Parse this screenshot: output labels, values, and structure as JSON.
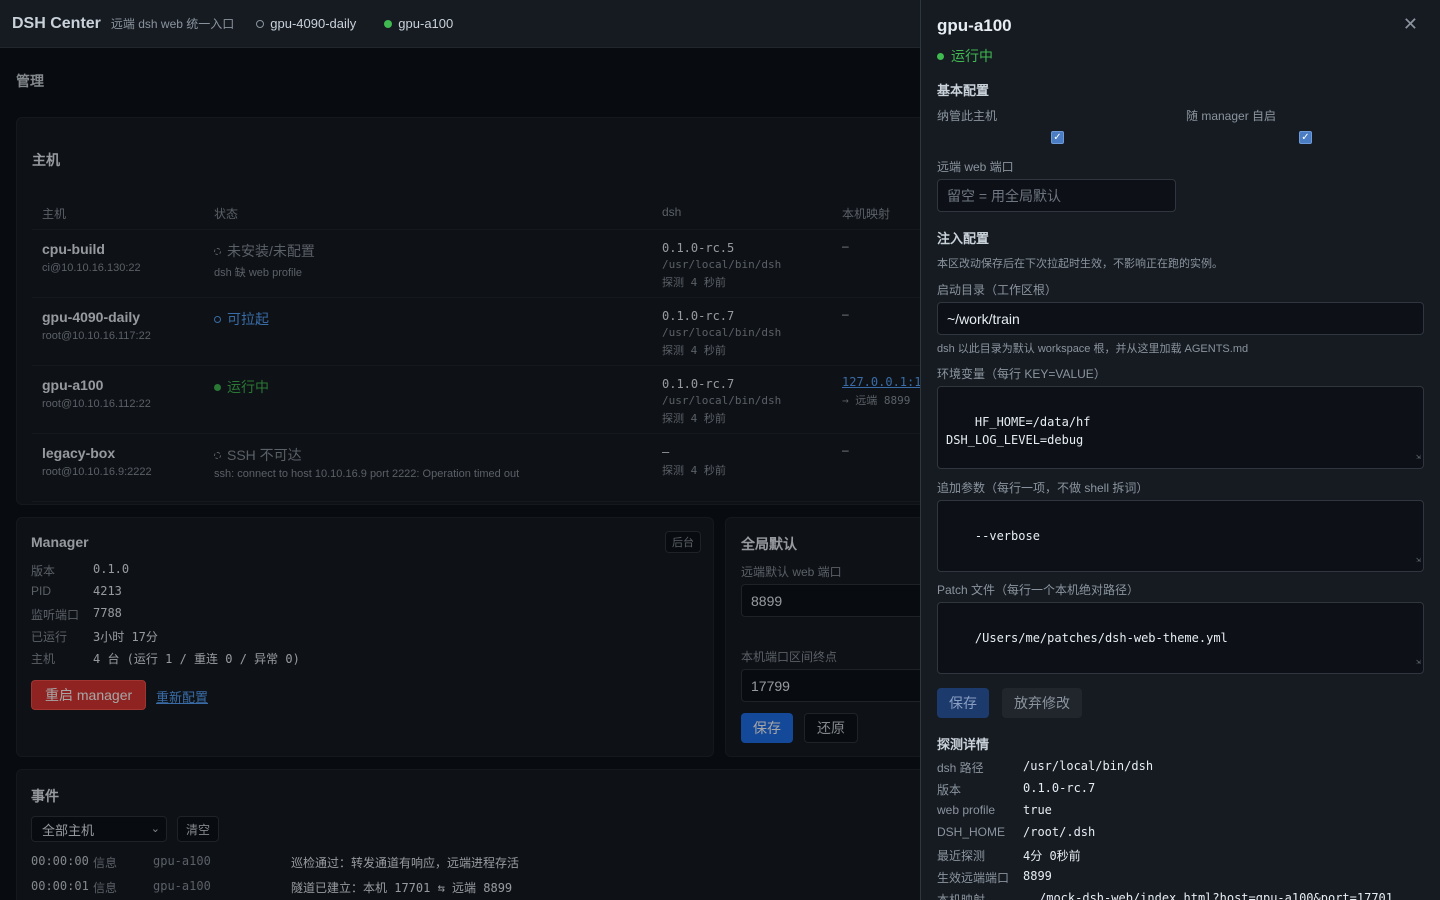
{
  "topbar": {
    "brand": "DSH Center",
    "subtitle": "远端 dsh web 统一入口",
    "tabs": [
      "gpu-4090-daily",
      "gpu-a100"
    ]
  },
  "page_title": "管理",
  "hosts": {
    "title": "主机",
    "columns": [
      "主机",
      "状态",
      "dsh",
      "本机映射"
    ],
    "rows": [
      {
        "name": "cpu-build",
        "addr": "ci@10.10.16.130:22",
        "status": "未安装/未配置",
        "status_sub": "dsh 缺 web profile",
        "version": "0.1.0-rc.5",
        "path": "/usr/local/bin/dsh",
        "probe": "探测 4 秒前",
        "map": "–",
        "map_sub": ""
      },
      {
        "name": "gpu-4090-daily",
        "addr": "root@10.10.16.117:22",
        "status": "可拉起",
        "status_sub": "",
        "version": "0.1.0-rc.7",
        "path": "/usr/local/bin/dsh",
        "probe": "探测 4 秒前",
        "map": "–",
        "map_sub": ""
      },
      {
        "name": "gpu-a100",
        "addr": "root@10.10.16.112:22",
        "status": "运行中",
        "status_sub": "",
        "version": "0.1.0-rc.7",
        "path": "/usr/local/bin/dsh",
        "probe": "探测 4 秒前",
        "map": "127.0.0.1:1",
        "map_sub": "→ 远端 8899"
      },
      {
        "name": "legacy-box",
        "addr": "root@10.10.16.9:2222",
        "status": "SSH 不可达",
        "status_sub": "ssh: connect to host 10.10.16.9 port 2222: Operation timed out",
        "version": "–",
        "path": "",
        "probe": "探测 4 秒前",
        "map": "–",
        "map_sub": ""
      }
    ]
  },
  "manager": {
    "title": "Manager",
    "badge": "后台",
    "fields": [
      {
        "k": "版本",
        "v": "0.1.0"
      },
      {
        "k": "PID",
        "v": "4213"
      },
      {
        "k": "监听端口",
        "v": "7788"
      },
      {
        "k": "已运行",
        "v": "3小时 17分"
      },
      {
        "k": "主机",
        "v": "4 台 (运行 1 / 重连 0 / 异常 0)"
      }
    ],
    "restart_label": "重启 manager",
    "reconfig_label": "重新配置"
  },
  "global": {
    "title": "全局默认",
    "port_label": "远端默认 web 端口",
    "port_value": "8899",
    "range_label": "本机端口区间终点",
    "range_value": "17799",
    "save_label": "保存",
    "reset_label": "还原"
  },
  "events": {
    "title": "事件",
    "filter": "全部主机",
    "clear_label": "清空",
    "items": [
      {
        "t": "00:00:00",
        "l": "信息",
        "h": "gpu-a100",
        "m": "巡检通过：转发通道有响应，远端进程存活"
      },
      {
        "t": "00:00:01",
        "l": "信息",
        "h": "gpu-a100",
        "m": "隧道已建立：本机 17701 ⇆ 远端 8899"
      }
    ]
  },
  "drawer": {
    "title": "gpu-a100",
    "status": "运行中",
    "basic_title": "基本配置",
    "manage_label": "纳管此主机",
    "autostart_label": "随 manager 自启",
    "port_label": "远端 web 端口",
    "port_placeholder": "留空 = 用全局默认",
    "inject_title": "注入配置",
    "inject_hint": "本区改动保存后在下次拉起时生效，不影响正在跑的实例。",
    "workdir_label": "启动目录（工作区根）",
    "workdir_value": "~/work/train",
    "workdir_hint": "dsh 以此目录为默认 workspace 根，并从这里加载 AGENTS.md",
    "env_label": "环境变量（每行 KEY=VALUE）",
    "env_value": "HF_HOME=/data/hf\nDSH_LOG_LEVEL=debug",
    "args_label": "追加参数（每行一项，不做 shell 拆词）",
    "args_value": "--verbose",
    "patch_label": "Patch 文件（每行一个本机绝对路径）",
    "patch_value": "/Users/me/patches/dsh-web-theme.yml",
    "save_label": "保存",
    "discard_label": "放弃修改",
    "probe_title": "探测详情",
    "probe": [
      {
        "k": "dsh 路径",
        "v": "/usr/local/bin/dsh"
      },
      {
        "k": "版本",
        "v": "0.1.0-rc.7"
      },
      {
        "k": "web profile",
        "v": "true"
      },
      {
        "k": "DSH_HOME",
        "v": "/root/.dsh"
      },
      {
        "k": "最近探测",
        "v": "4分 0秒前"
      },
      {
        "k": "生效远端端口",
        "v": "8899"
      },
      {
        "k": "本机映射",
        "v": "/mock-dsh-web/index.html?host=gpu-a100&port=17701"
      }
    ]
  },
  "colors": {
    "running": "#3fb950",
    "startable": "#58a6ff",
    "danger": "#da3633",
    "primary": "#1f6feb"
  }
}
